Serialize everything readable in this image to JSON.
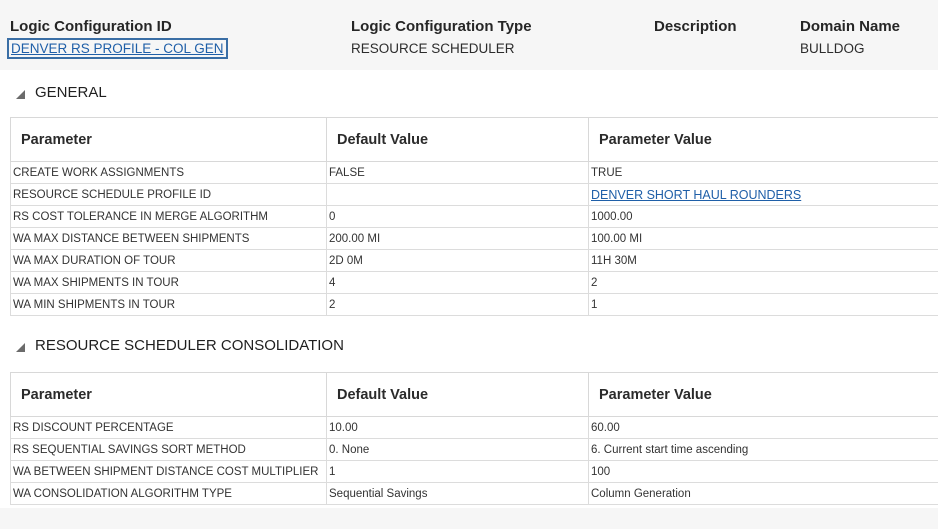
{
  "header": {
    "logic_config_id_label": "Logic Configuration ID",
    "logic_config_id_value": "DENVER RS PROFILE - COL GEN",
    "logic_config_type_label": "Logic Configuration Type",
    "logic_config_type_value": "RESOURCE SCHEDULER",
    "description_label": "Description",
    "domain_name_label": "Domain Name",
    "domain_name_value": "BULLDOG"
  },
  "general": {
    "title": "GENERAL",
    "columns": [
      "Parameter",
      "Default Value",
      "Parameter Value"
    ],
    "rows": [
      {
        "parameter": "CREATE WORK ASSIGNMENTS",
        "default": "FALSE",
        "value": "TRUE"
      },
      {
        "parameter": "RESOURCE SCHEDULE PROFILE ID",
        "default": "",
        "value": "DENVER SHORT HAUL ROUNDERS"
      },
      {
        "parameter": "RS COST TOLERANCE IN MERGE ALGORITHM",
        "default": "0",
        "value": "1000.00"
      },
      {
        "parameter": "WA MAX DISTANCE BETWEEN SHIPMENTS",
        "default": "200.00 MI",
        "value": "100.00 MI"
      },
      {
        "parameter": "WA MAX DURATION OF TOUR",
        "default": "2D 0M",
        "value": "11H 30M"
      },
      {
        "parameter": "WA MAX SHIPMENTS IN TOUR",
        "default": "4",
        "value": "2"
      },
      {
        "parameter": "WA MIN SHIPMENTS IN TOUR",
        "default": "2",
        "value": "1"
      }
    ]
  },
  "consolidation": {
    "title": "RESOURCE SCHEDULER CONSOLIDATION",
    "columns": [
      "Parameter",
      "Default Value",
      "Parameter Value"
    ],
    "rows": [
      {
        "parameter": "RS DISCOUNT PERCENTAGE",
        "default": "10.00",
        "value": "60.00"
      },
      {
        "parameter": "RS SEQUENTIAL SAVINGS SORT METHOD",
        "default": "0. None",
        "value": "6. Current start time ascending"
      },
      {
        "parameter": "WA BETWEEN SHIPMENT DISTANCE COST MULTIPLIER",
        "default": "1",
        "value": "100"
      },
      {
        "parameter": "WA CONSOLIDATION ALGORITHM TYPE",
        "default": "Sequential Savings",
        "value": "Column Generation"
      }
    ]
  },
  "colors": {
    "link": "#1f5fa8",
    "panel_bg": "#ffffff",
    "page_bg": "#f6f6f6"
  }
}
